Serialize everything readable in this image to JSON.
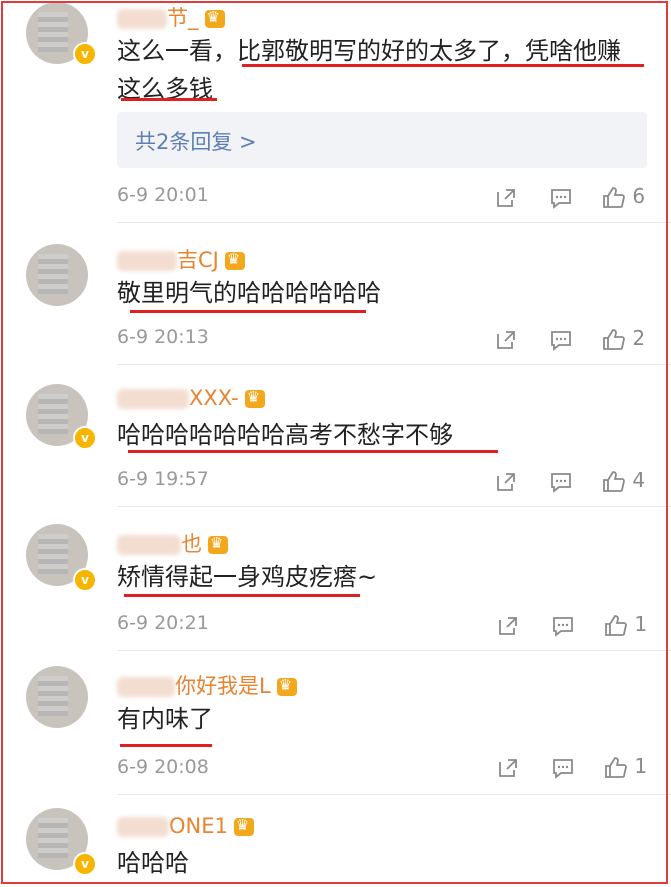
{
  "comments": [
    {
      "username_visible": "节_",
      "text_line1": "这么一看，比郭敬明写的好的太多了，凭啥他赚",
      "text_line2": "这么多钱",
      "replies_label": "共2条回复 >",
      "time": "6-9 20:01",
      "likes": "6"
    },
    {
      "username_visible": "吉CJ",
      "text_line1": "敬里明气的哈哈哈哈哈哈",
      "time": "6-9 20:13",
      "likes": "2"
    },
    {
      "username_visible": "XXX-",
      "text_line1": "哈哈哈哈哈哈哈高考不愁字不够",
      "time": "6-9 19:57",
      "likes": "4"
    },
    {
      "username_visible": "也",
      "text_line1": "矫情得起一身鸡皮疙瘩~",
      "time": "6-9 20:21",
      "likes": "1"
    },
    {
      "username_visible": "你好我是L",
      "text_line1": "有内味了",
      "time": "6-9 20:08",
      "likes": "1"
    },
    {
      "username_visible": "ONE1",
      "text_line1": "哈哈哈"
    }
  ],
  "icons": {
    "share": "share-icon",
    "comment": "comment-icon",
    "like": "like-icon",
    "verified": "verified-badge-icon",
    "member": "crown-icon"
  },
  "colors": {
    "username": "#e8832f",
    "underline": "#e02020",
    "frame": "#e23b3b",
    "reply_link": "#5f7fb2"
  }
}
